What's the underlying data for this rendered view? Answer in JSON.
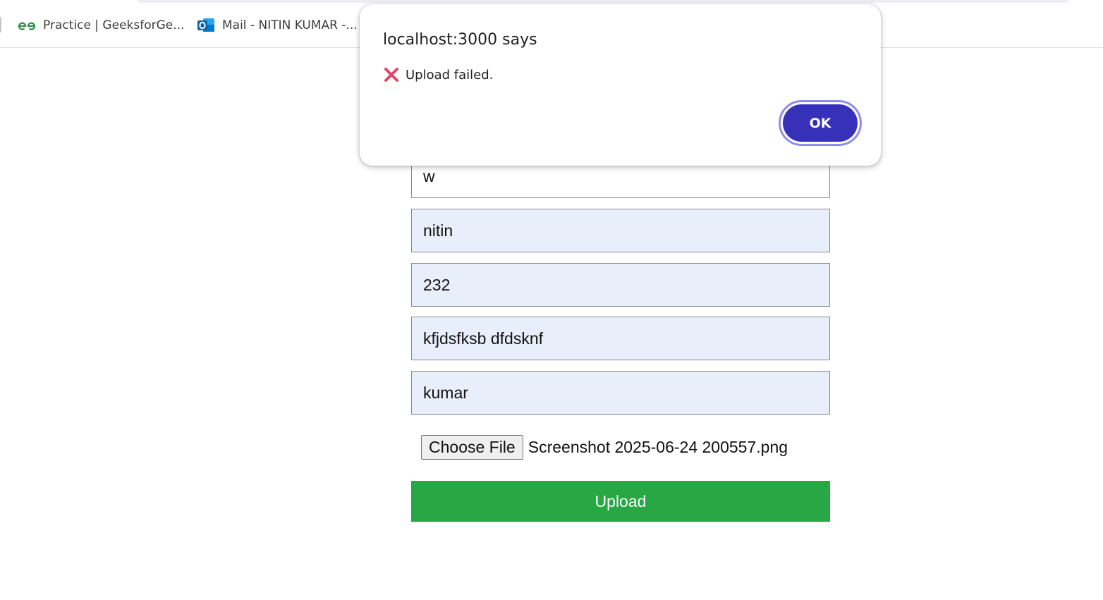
{
  "browser": {
    "bookmarks": [
      {
        "label": "Practice | GeeksforGe...",
        "icon": "geeksforgeeks-icon"
      },
      {
        "label": "Mail - NITIN KUMAR -...",
        "icon": "outlook-icon"
      }
    ]
  },
  "form": {
    "fields": [
      "w",
      "nitin",
      "232",
      "kfjdsfksb dfdsknf",
      "kumar"
    ],
    "file": {
      "button_label": "Choose File",
      "file_name": "Screenshot 2025-06-24 200557.png"
    },
    "upload_label": "Upload",
    "colors": {
      "upload": "#28a745",
      "field_bg": "#e8effb"
    }
  },
  "dialog": {
    "title": "localhost:3000 says",
    "icon": "cross-mark-icon",
    "message": "Upload failed.",
    "ok_label": "OK",
    "colors": {
      "ok": "#3730b9",
      "icon": "#e0456b"
    }
  }
}
